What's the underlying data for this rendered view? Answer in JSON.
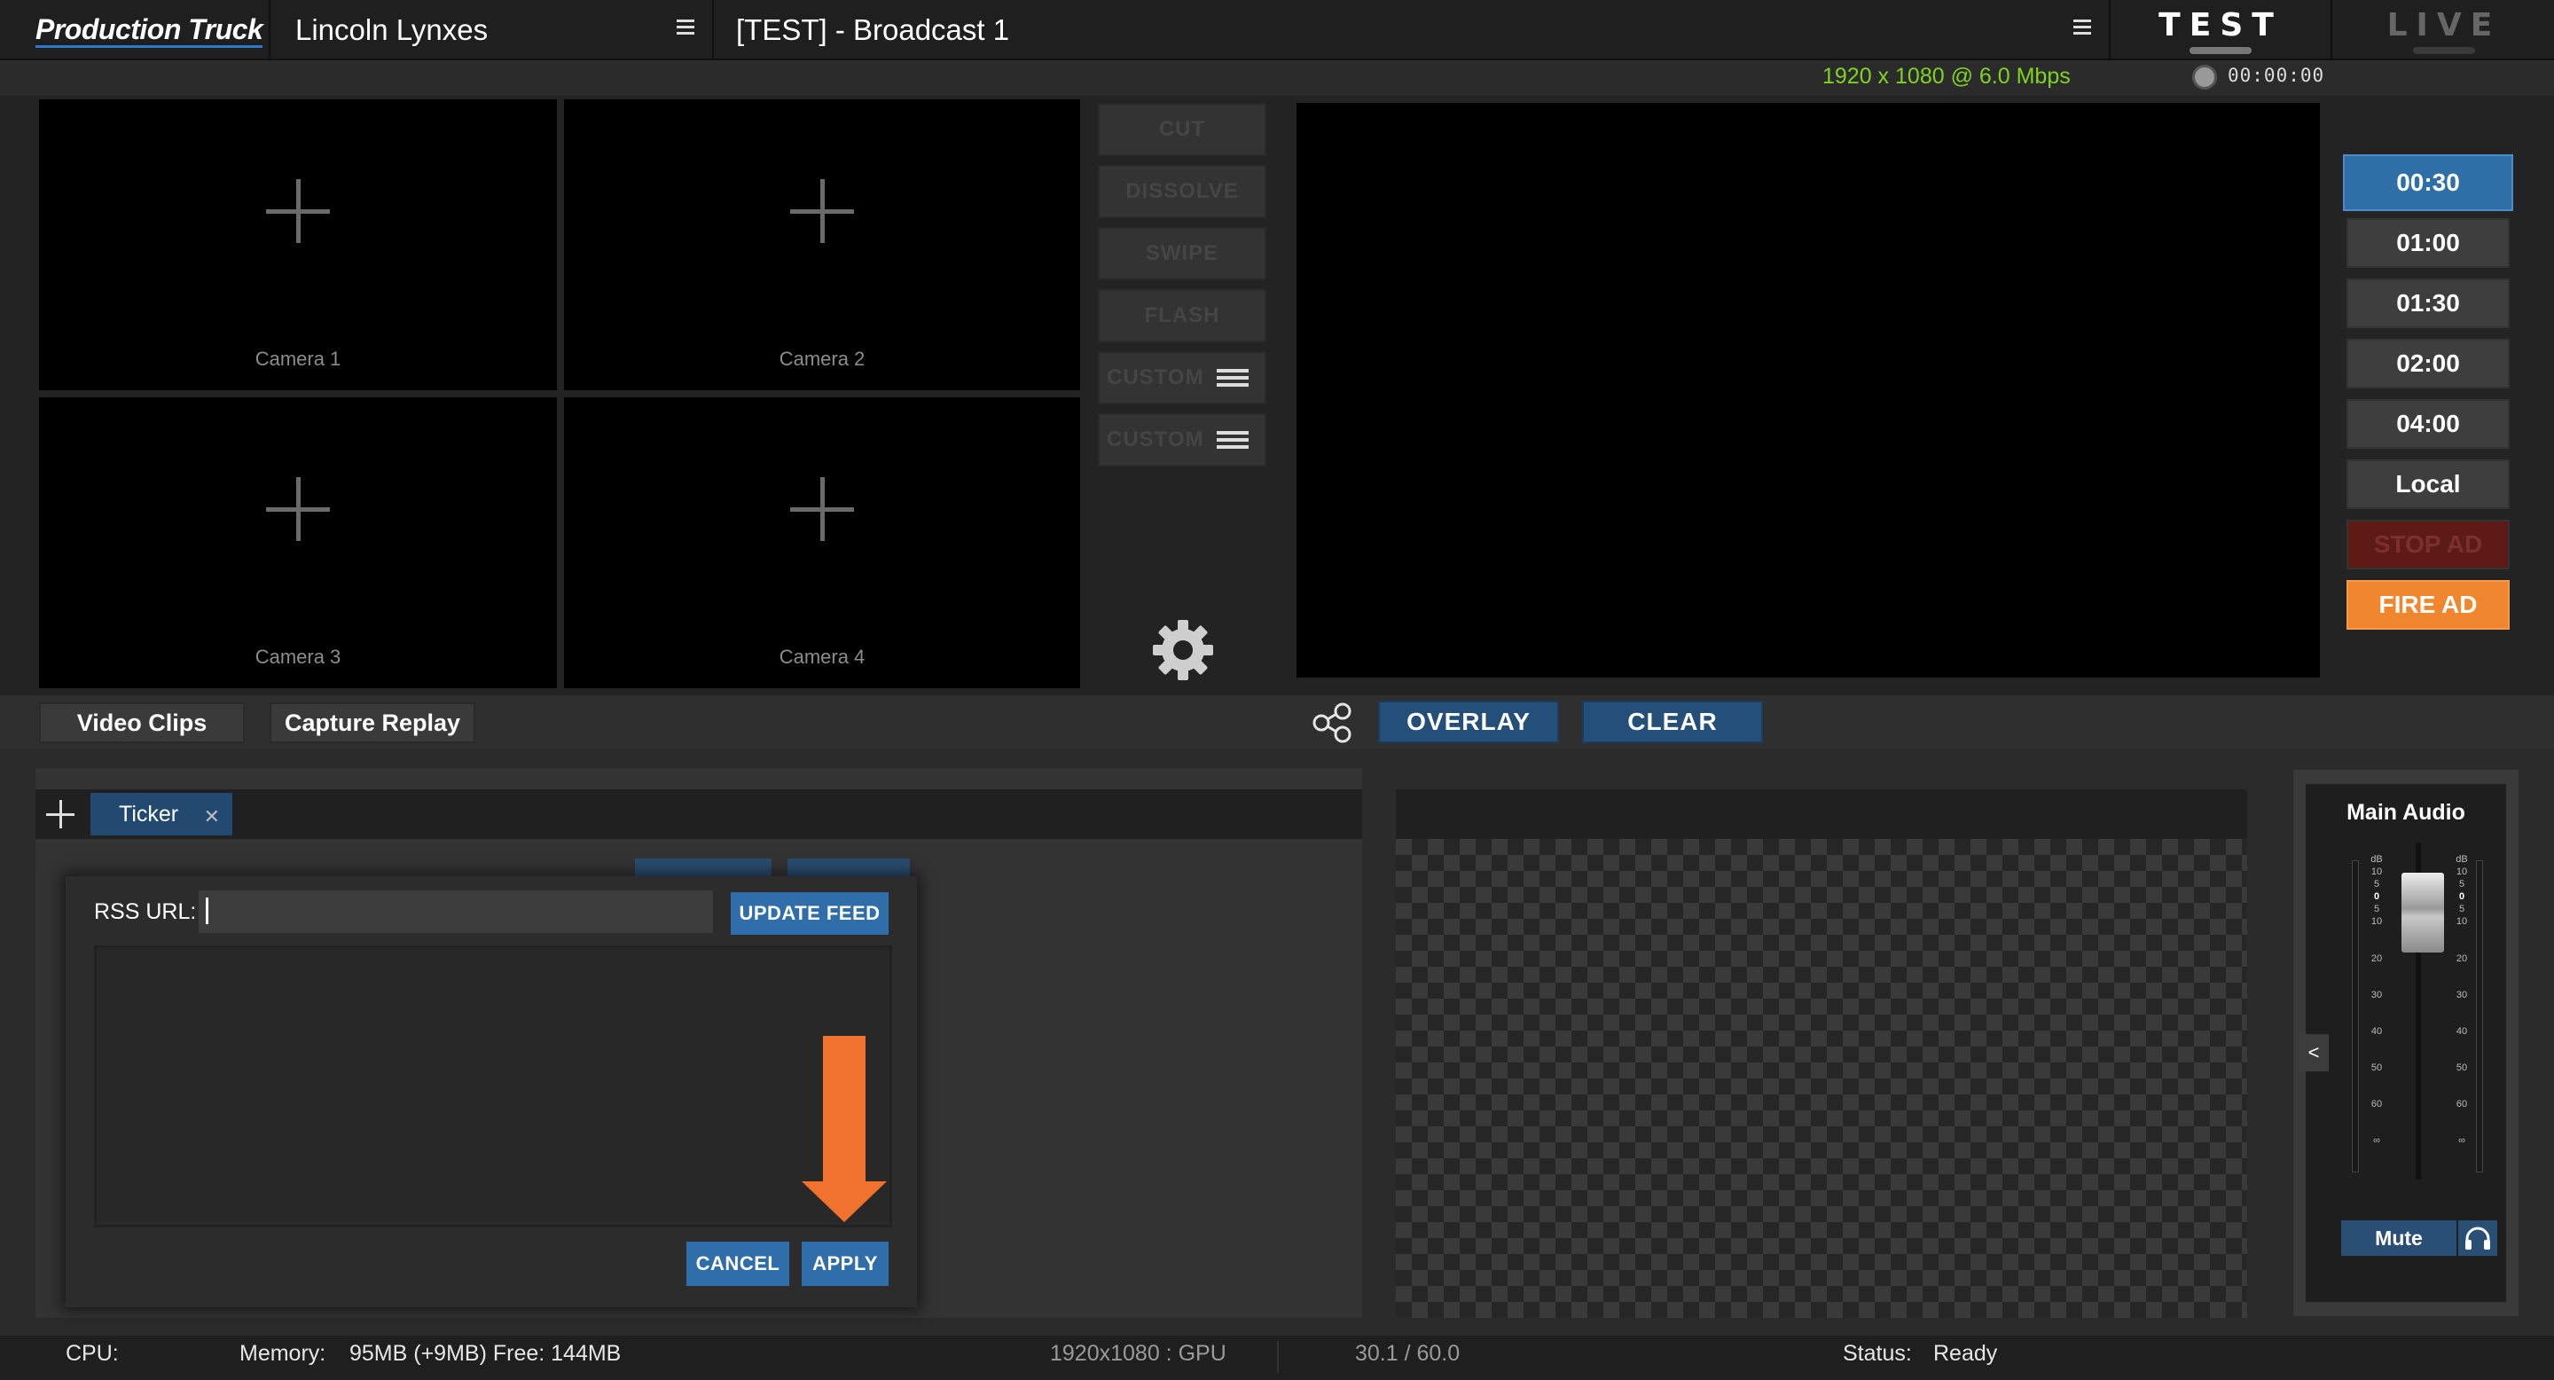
{
  "header": {
    "brand": "Production Truck",
    "team": "Lincoln Lynxes",
    "broadcast": "[TEST] - Broadcast 1",
    "mode_test": "TEST",
    "mode_live": "LIVE"
  },
  "stream": {
    "info": "1920 x 1080 @ 6.0 Mbps",
    "rec_time": "00:00:00"
  },
  "cameras": [
    "Camera 1",
    "Camera 2",
    "Camera 3",
    "Camera 4"
  ],
  "transitions": [
    "CUT",
    "DISSOLVE",
    "SWIPE",
    "FLASH",
    "CUSTOM",
    "CUSTOM"
  ],
  "ad_timers": [
    "00:30",
    "01:00",
    "01:30",
    "02:00",
    "04:00",
    "Local",
    "STOP AD",
    "FIRE AD"
  ],
  "strip": {
    "video_clips": "Video Clips",
    "capture_replay": "Capture Replay",
    "overlay": "OVERLAY",
    "clear": "CLEAR"
  },
  "graphics": {
    "tab_label": "Ticker"
  },
  "dialog": {
    "rss_label": "RSS URL:",
    "rss_value": "",
    "update_label": "UPDATE FEED",
    "cancel_label": "CANCEL",
    "apply_label": "APPLY"
  },
  "audio": {
    "title": "Main Audio",
    "mute": "Mute",
    "collapse": "<",
    "scale_unit": "dB",
    "scale_top": [
      "10",
      "5",
      "0",
      "5",
      "10"
    ],
    "scale_marks": [
      "20",
      "30",
      "40",
      "50",
      "60",
      "∞"
    ]
  },
  "status": {
    "cpu_label": "CPU:",
    "memory_label": "Memory:",
    "memory_value": "95MB (+9MB) Free: 144MB",
    "resolution": "1920x1080 : GPU",
    "fps": "30.1 / 60.0",
    "status_label": "Status:",
    "status_value": "Ready"
  },
  "colors": {
    "accent_blue": "#2f6ea8",
    "fire_orange": "#f0862d",
    "stream_green": "#7ed321",
    "stop_red": "#5e1a17"
  }
}
